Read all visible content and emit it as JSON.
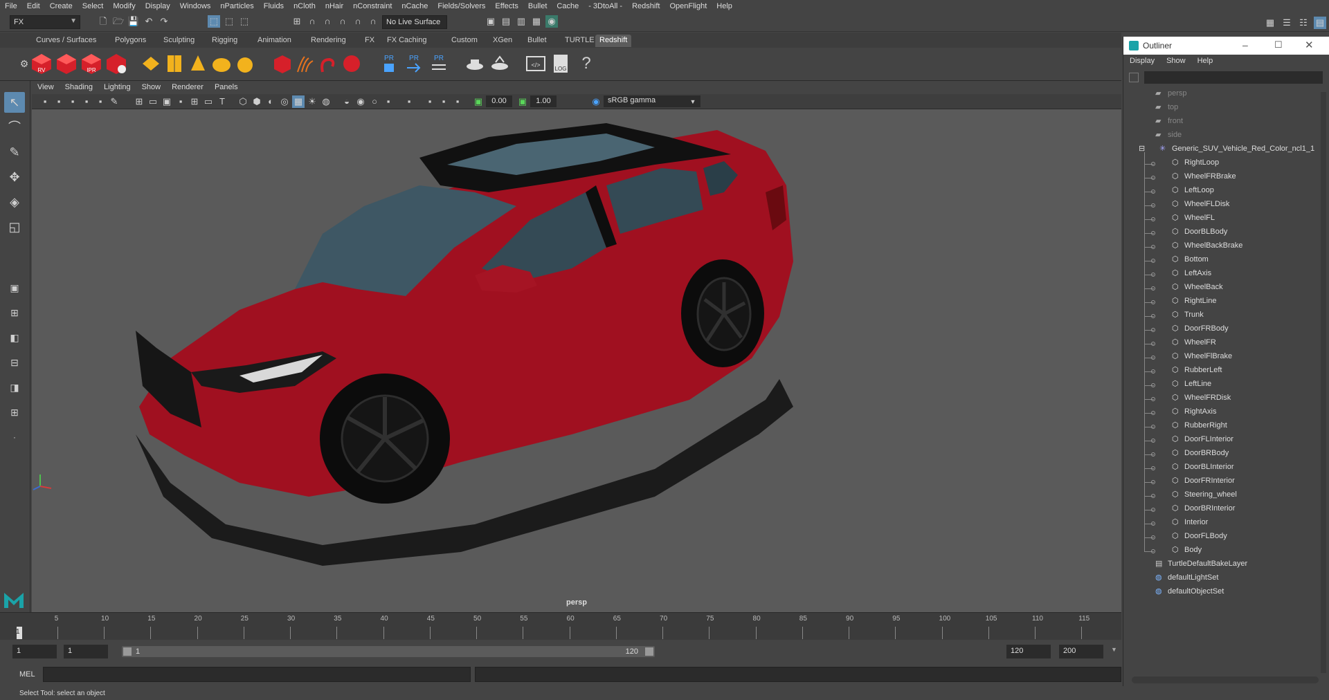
{
  "menubar": {
    "items": [
      "File",
      "Edit",
      "Create",
      "Select",
      "Modify",
      "Display",
      "Windows",
      "nParticles",
      "Fluids",
      "nCloth",
      "nHair",
      "nConstraint",
      "nCache",
      "Fields/Solvers",
      "Effects",
      "Bullet",
      "Cache",
      "- 3DtoAll -",
      "Redshift",
      "OpenFlight",
      "Help"
    ]
  },
  "statusline": {
    "mode": "FX",
    "live_surface": "No Live Surface"
  },
  "shelf": {
    "tabs": [
      "Curves / Surfaces",
      "Polygons",
      "Sculpting",
      "Rigging",
      "Animation",
      "Rendering",
      "FX",
      "FX Caching",
      "Custom",
      "XGen",
      "Bullet",
      "TURTLE",
      "Redshift"
    ],
    "active_tab": "Redshift",
    "icon_labels": {
      "rv": "RV",
      "ipr": "IPR",
      "pr": "PR",
      "log": "LOG"
    }
  },
  "viewport": {
    "menu": [
      "View",
      "Shading",
      "Lighting",
      "Show",
      "Renderer",
      "Panels"
    ],
    "exposure": "0.00",
    "gamma_value": "1.00",
    "color_space": "sRGB gamma",
    "camera_label": "persp",
    "car_color": "#a01020"
  },
  "timeline": {
    "current_frame_marker": "1",
    "ticks": [
      "5",
      "10",
      "15",
      "20",
      "25",
      "30",
      "35",
      "40",
      "45",
      "50",
      "55",
      "60",
      "65",
      "70",
      "75",
      "80",
      "85",
      "90",
      "95",
      "100",
      "105",
      "110",
      "115"
    ]
  },
  "range": {
    "start": "1",
    "playback_start": "1",
    "slider_start": "1",
    "slider_end": "120",
    "playback_end": "120",
    "end": "200"
  },
  "commandline": {
    "label": "MEL"
  },
  "helpline": {
    "text": "Select Tool: select an object"
  },
  "outliner": {
    "title": "Outliner",
    "menu": [
      "Display",
      "Show",
      "Help"
    ],
    "cameras": [
      "persp",
      "top",
      "front",
      "side"
    ],
    "group": "Generic_SUV_Vehicle_Red_Color_ncl1_1",
    "children": [
      "RightLoop",
      "WheelFRBrake",
      "LeftLoop",
      "WheelFLDisk",
      "WheelFL",
      "DoorBLBody",
      "WheelBackBrake",
      "Bottom",
      "LeftAxis",
      "WheelBack",
      "RightLine",
      "Trunk",
      "DoorFRBody",
      "WheelFR",
      "WheelFlBrake",
      "RubberLeft",
      "LeftLine",
      "WheelFRDisk",
      "RightAxis",
      "RubberRight",
      "DoorFLInterior",
      "DoorBRBody",
      "DoorBLInterior",
      "DoorFRInterior",
      "Steering_wheel",
      "DoorBRInterior",
      "Interior",
      "DoorFLBody",
      "Body"
    ],
    "sets": [
      "TurtleDefaultBakeLayer",
      "defaultLightSet",
      "defaultObjectSet"
    ]
  }
}
